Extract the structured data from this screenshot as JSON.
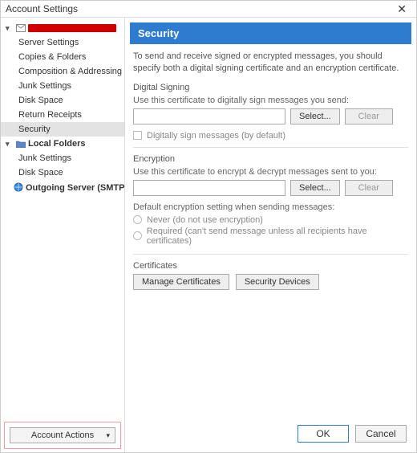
{
  "window": {
    "title": "Account Settings",
    "close": "✕"
  },
  "sidebar": {
    "account_redacted": true,
    "items": [
      "Server Settings",
      "Copies & Folders",
      "Composition & Addressing",
      "Junk Settings",
      "Disk Space",
      "Return Receipts",
      "Security"
    ],
    "local_folders_label": "Local Folders",
    "local_folders_items": [
      "Junk Settings",
      "Disk Space"
    ],
    "smtp_label": "Outgoing Server (SMTP)",
    "account_actions": "Account Actions"
  },
  "content": {
    "title": "Security",
    "intro": "To send and receive signed or encrypted messages, you should specify both a digital signing certificate and an encryption certificate.",
    "signing": {
      "label": "Digital Signing",
      "desc": "Use this certificate to digitally sign messages you send:",
      "value": "",
      "select": "Select...",
      "clear": "Clear",
      "checkbox": "Digitally sign messages (by default)"
    },
    "encryption": {
      "label": "Encryption",
      "desc": "Use this certificate to encrypt & decrypt messages sent to you:",
      "value": "",
      "select": "Select...",
      "clear": "Clear",
      "default_label": "Default encryption setting when sending messages:",
      "never": "Never (do not use encryption)",
      "required": "Required (can't send message unless all recipients have certificates)"
    },
    "certs": {
      "label": "Certificates",
      "manage": "Manage Certificates",
      "devices": "Security Devices"
    }
  },
  "footer": {
    "ok": "OK",
    "cancel": "Cancel"
  }
}
